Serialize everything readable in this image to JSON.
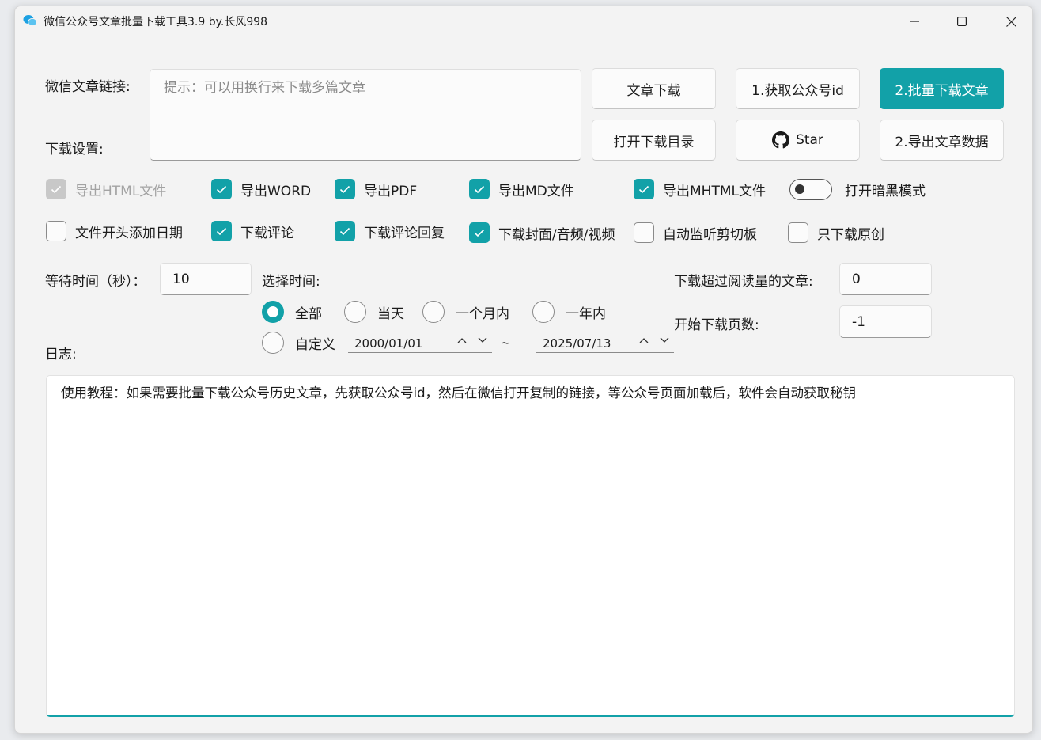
{
  "window": {
    "title": "微信公众号文章批量下载工具3.9 by.长风998"
  },
  "form": {
    "url_label": "微信文章链接:",
    "url_placeholder": "提示：可以用换行来下载多篇文章",
    "settings_label": "下载设置:"
  },
  "buttons": {
    "download_article": "文章下载",
    "get_account_id": "1.获取公众号id",
    "batch_download": "2.批量下载文章",
    "open_download_dir": "打开下载目录",
    "star": "Star",
    "export_article_data": "2.导出文章数据"
  },
  "options": {
    "export_html": {
      "label": "导出HTML文件",
      "checked": true,
      "disabled": true
    },
    "export_word": {
      "label": "导出WORD",
      "checked": true
    },
    "export_pdf": {
      "label": "导出PDF",
      "checked": true
    },
    "export_md": {
      "label": "导出MD文件",
      "checked": true
    },
    "export_mhtml": {
      "label": "导出MHTML文件",
      "checked": true
    },
    "dark_mode": {
      "label": "打开暗黑模式",
      "on": false
    },
    "date_prefix": {
      "label": "文件开头添加日期",
      "checked": false
    },
    "download_comments": {
      "label": "下载评论",
      "checked": true
    },
    "download_comment_replies": {
      "label": "下载评论回复",
      "checked": true
    },
    "download_media": {
      "label": "下载封面/音频/视频",
      "checked": true
    },
    "monitor_clipboard": {
      "label": "自动监听剪切板",
      "checked": false
    },
    "original_only": {
      "label": "只下载原创",
      "checked": false
    }
  },
  "wait": {
    "label": "等待时间（秒）：",
    "value": "10"
  },
  "time_range": {
    "label": "选择时间:",
    "options": [
      "全部",
      "当天",
      "一个月内",
      "一年内",
      "自定义"
    ],
    "selected": "全部",
    "start_date": "2000/01/01",
    "separator": "~",
    "end_date": "2025/07/13"
  },
  "read_filter": {
    "label": "下载超过阅读量的文章:",
    "value": "0"
  },
  "start_page": {
    "label": "开始下载页数:",
    "value": "-1"
  },
  "log": {
    "label": "日志:",
    "text": "使用教程：如果需要批量下载公众号历史文章，先获取公众号id，然后在微信打开复制的链接，等公众号页面加载后，软件会自动获取秘钥"
  },
  "colors": {
    "accent": "#12a1a8"
  }
}
